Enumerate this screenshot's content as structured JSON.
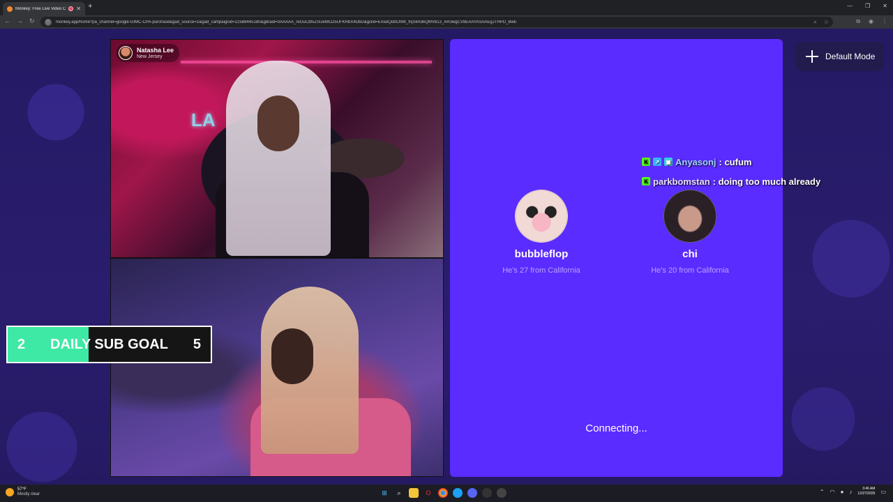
{
  "browser": {
    "tab_title": "Monkey: Free Live Video Ch",
    "tab_close": "✕",
    "new_tab": "+",
    "url": "monkey.app/home?pa_channel=google-GIMC-CPA-purchase&gad_source=1&gad_campaignid=22588445180&gbraid=0AAAAA_reOuCdfoZSUeMCD5UFKRbX4DbD&gclid=EAIaIQobChMI_fnjS6XdkQMVb13_AR3wgCV8EAAYASAAEgJTHPD_BwE",
    "site_icon": "info-icon"
  },
  "cam_top": {
    "caller_name": "Natasha Lee",
    "caller_location": "New Jersey",
    "sign_text": "LA"
  },
  "sub_goal": {
    "current": "2",
    "label": "DAILY SUB GOAL",
    "target": "5",
    "progress": 0.4,
    "fill_color": "#3ee8a5"
  },
  "matches": [
    {
      "name": "bubbleflop",
      "desc": "He's 27 from California"
    },
    {
      "name": "chi",
      "desc": "He's 20 from California"
    }
  ],
  "status": "Connecting...",
  "chat": [
    {
      "user": "Anyasonj",
      "message": ": cufum"
    },
    {
      "user": "parkbomstan",
      "message": ": doing too much already"
    }
  ],
  "mode_button": {
    "label": "Default Mode"
  },
  "taskbar": {
    "temperature": "57°F",
    "condition": "Mostly clear",
    "time": "3:46 AM",
    "date": "12/27/2025"
  },
  "colors": {
    "panel": "#5b2cff",
    "page_bg": "#241a63",
    "kick_green": "#53fc18"
  }
}
